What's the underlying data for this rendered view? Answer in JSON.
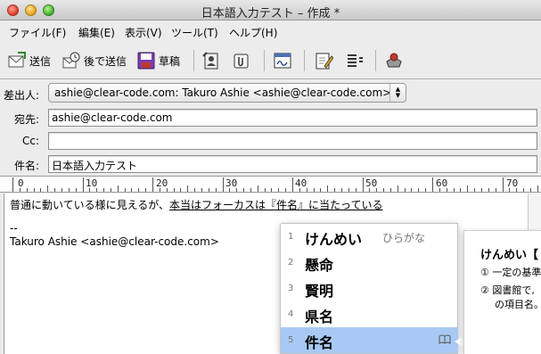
{
  "window": {
    "title": "日本語入力テスト – 作成 *"
  },
  "menu": [
    "ファイル(F)",
    "編集(E)",
    "表示(V)",
    "ツール(T)",
    "ヘルプ(H)"
  ],
  "toolbar": {
    "send": "送信",
    "send_later": "後で送信",
    "draft": "草稿"
  },
  "headers": {
    "from_label": "差出人:",
    "from_value": "ashie@clear-code.com: Takuro Ashie <ashie@clear-code.com>",
    "to_label": "宛先:",
    "to_value": "ashie@clear-code.com",
    "cc_label": "Cc:",
    "cc_value": "",
    "subject_label": "件名:",
    "subject_value": "日本語入力テスト"
  },
  "ruler": [
    "0",
    "10",
    "20",
    "30",
    "40",
    "50",
    "60",
    "70"
  ],
  "body": {
    "line1_plain": "普通に動いている様に見えるが、",
    "line1_underlined": "本当はフォーカスは『件名』に当たっている",
    "sig_sep": "--",
    "sig": "Takuro Ashie <ashie@clear-code.com>"
  },
  "candidates": [
    {
      "num": "1",
      "text": "けんめい",
      "hint": "ひらがな"
    },
    {
      "num": "2",
      "text": "懸命",
      "hint": ""
    },
    {
      "num": "3",
      "text": "賢明",
      "hint": ""
    },
    {
      "num": "4",
      "text": "県名",
      "hint": ""
    },
    {
      "num": "5",
      "text": "件名",
      "hint": ""
    }
  ],
  "selected_candidate": "5",
  "dictionary": {
    "heading": "けんめい【",
    "line1": "① 一定の基準",
    "line2": "② 図書館で,",
    "line3": "の項目名。"
  }
}
